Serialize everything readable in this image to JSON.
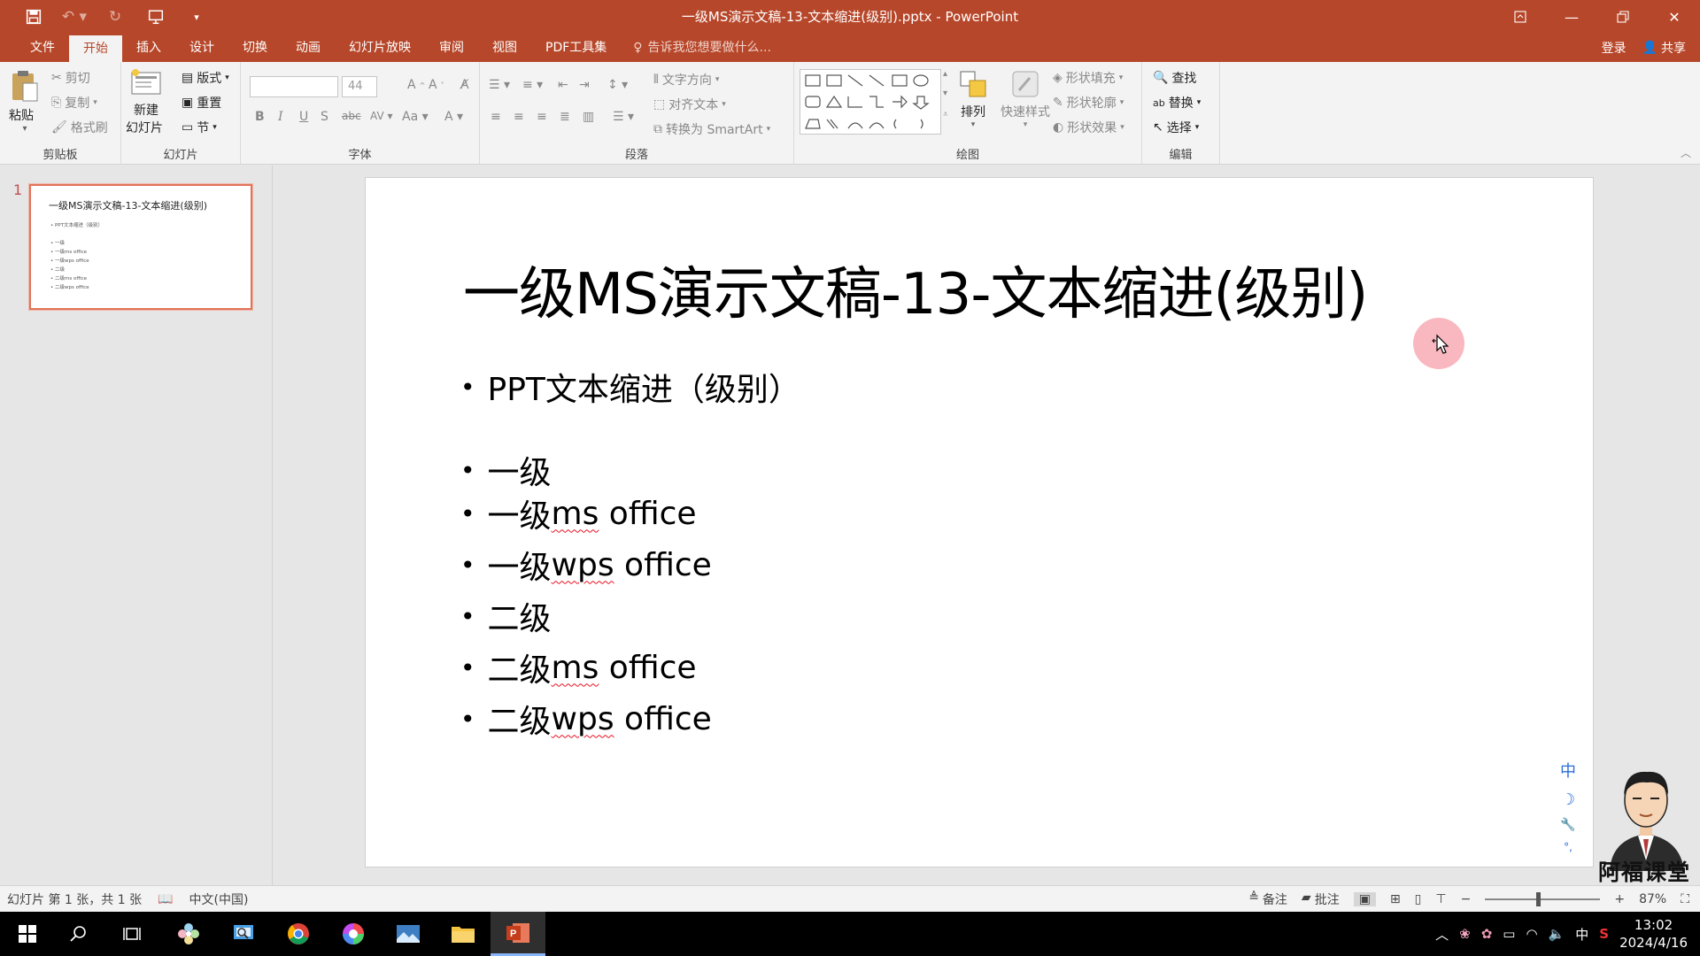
{
  "window": {
    "title": "一级MS演示文稿-13-文本缩进(级别).pptx - PowerPoint"
  },
  "ribbon_tabs": [
    {
      "label": "文件"
    },
    {
      "label": "开始"
    },
    {
      "label": "插入"
    },
    {
      "label": "设计"
    },
    {
      "label": "切换"
    },
    {
      "label": "动画"
    },
    {
      "label": "幻灯片放映"
    },
    {
      "label": "审阅"
    },
    {
      "label": "视图"
    },
    {
      "label": "PDF工具集"
    }
  ],
  "tell_me": "告诉我您想要做什么...",
  "account": {
    "login": "登录",
    "share": "共享"
  },
  "clipboard": {
    "paste": "粘贴",
    "cut": "剪切",
    "copy": "复制",
    "format_painter": "格式刷",
    "label": "剪贴板"
  },
  "slides_group": {
    "new_slide_line1": "新建",
    "new_slide_line2": "幻灯片",
    "layout": "版式",
    "reset": "重置",
    "section": "节",
    "label": "幻灯片"
  },
  "font_group": {
    "font_name": "",
    "font_size": "44",
    "label": "字体"
  },
  "paragraph_group": {
    "text_direction": "文字方向",
    "align_text": "对齐文本",
    "smartart": "转换为 SmartArt",
    "label": "段落"
  },
  "drawing_group": {
    "arrange": "排列",
    "quick_styles": "快速样式",
    "shape_fill": "形状填充",
    "shape_outline": "形状轮廓",
    "shape_effects": "形状效果",
    "label": "绘图"
  },
  "editing_group": {
    "find": "查找",
    "replace": "替换",
    "select": "选择",
    "label": "编辑"
  },
  "thumbnail": {
    "number": "1",
    "title": "一级MS演示文稿-13-文本缩进(级别)",
    "lines": [
      "• PPT文本缩进（级别）",
      "• 一级",
      "• 一级ms office",
      "• 一级wps office",
      "• 二级",
      "• 二级ms office",
      "• 二级wps office"
    ]
  },
  "slide": {
    "title": "一级MS演示文稿-13-文本缩进(级别)",
    "bullets": [
      {
        "cn": "PPT文本缩进（级别）",
        "en": ""
      },
      {
        "cn": "一级",
        "en": ""
      },
      {
        "cn": "一级",
        "en": "ms",
        "rest": " office"
      },
      {
        "cn": "一级",
        "en": "wps",
        "rest": " office"
      },
      {
        "cn": "二级",
        "en": ""
      },
      {
        "cn": "二级",
        "en": "ms",
        "rest": " office"
      },
      {
        "cn": "二级",
        "en": "wps",
        "rest": " office"
      }
    ]
  },
  "side_tools": [
    "中",
    "☽",
    "🔧",
    "°,"
  ],
  "watermark": "阿福课堂",
  "status": {
    "slide_info": "幻灯片 第 1 张，共 1 张",
    "language": "中文(中国)",
    "notes": "备注",
    "comments": "批注",
    "zoom": "87%"
  },
  "taskbar": {
    "ime": "中",
    "time": "13:02",
    "date": "2024/4/16"
  },
  "colors": {
    "accent": "#b7472a",
    "thumb_border": "#e2735a"
  }
}
